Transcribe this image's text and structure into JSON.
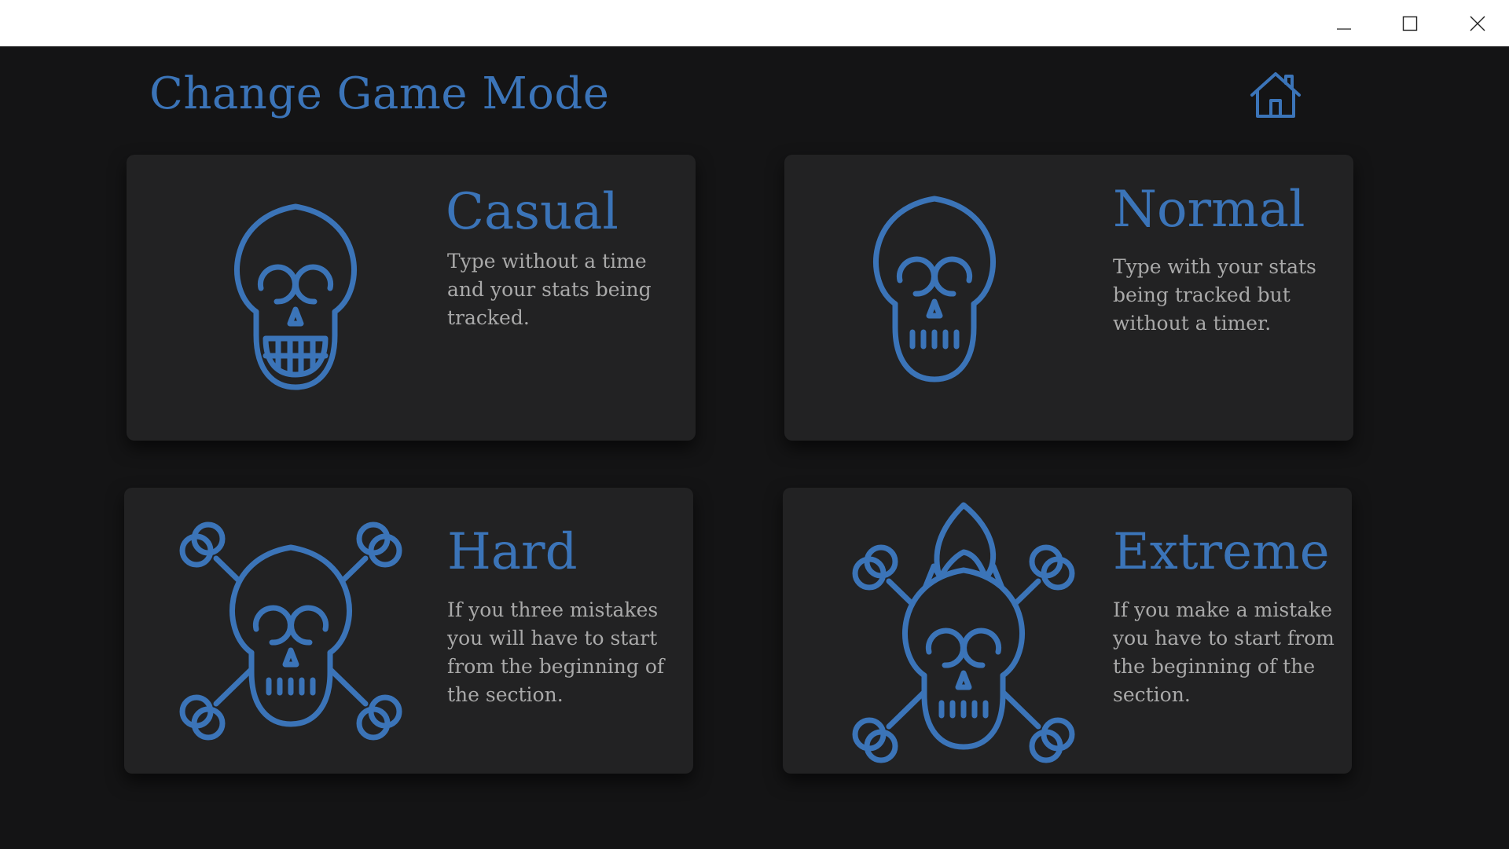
{
  "window": {
    "controls": [
      "minimize",
      "maximize",
      "close"
    ]
  },
  "header": {
    "title": "Change Game Mode",
    "home_icon": "home-icon"
  },
  "accent_color": "#3b74b8",
  "modes": [
    {
      "id": "casual",
      "title": "Casual",
      "description": "Type without a time and your stats being tracked.",
      "icon": "skull-teeth-icon"
    },
    {
      "id": "normal",
      "title": "Normal",
      "description": "Type with your stats being tracked but without a timer.",
      "icon": "skull-icon"
    },
    {
      "id": "hard",
      "title": "Hard",
      "description": "If you three mistakes you will have to start from the beginning of the section.",
      "icon": "skull-crossbones-icon"
    },
    {
      "id": "extreme",
      "title": "Extreme",
      "description": "If you make a mistake you have to start from the beginning of the section.",
      "icon": "flaming-skull-crossbones-icon"
    }
  ]
}
